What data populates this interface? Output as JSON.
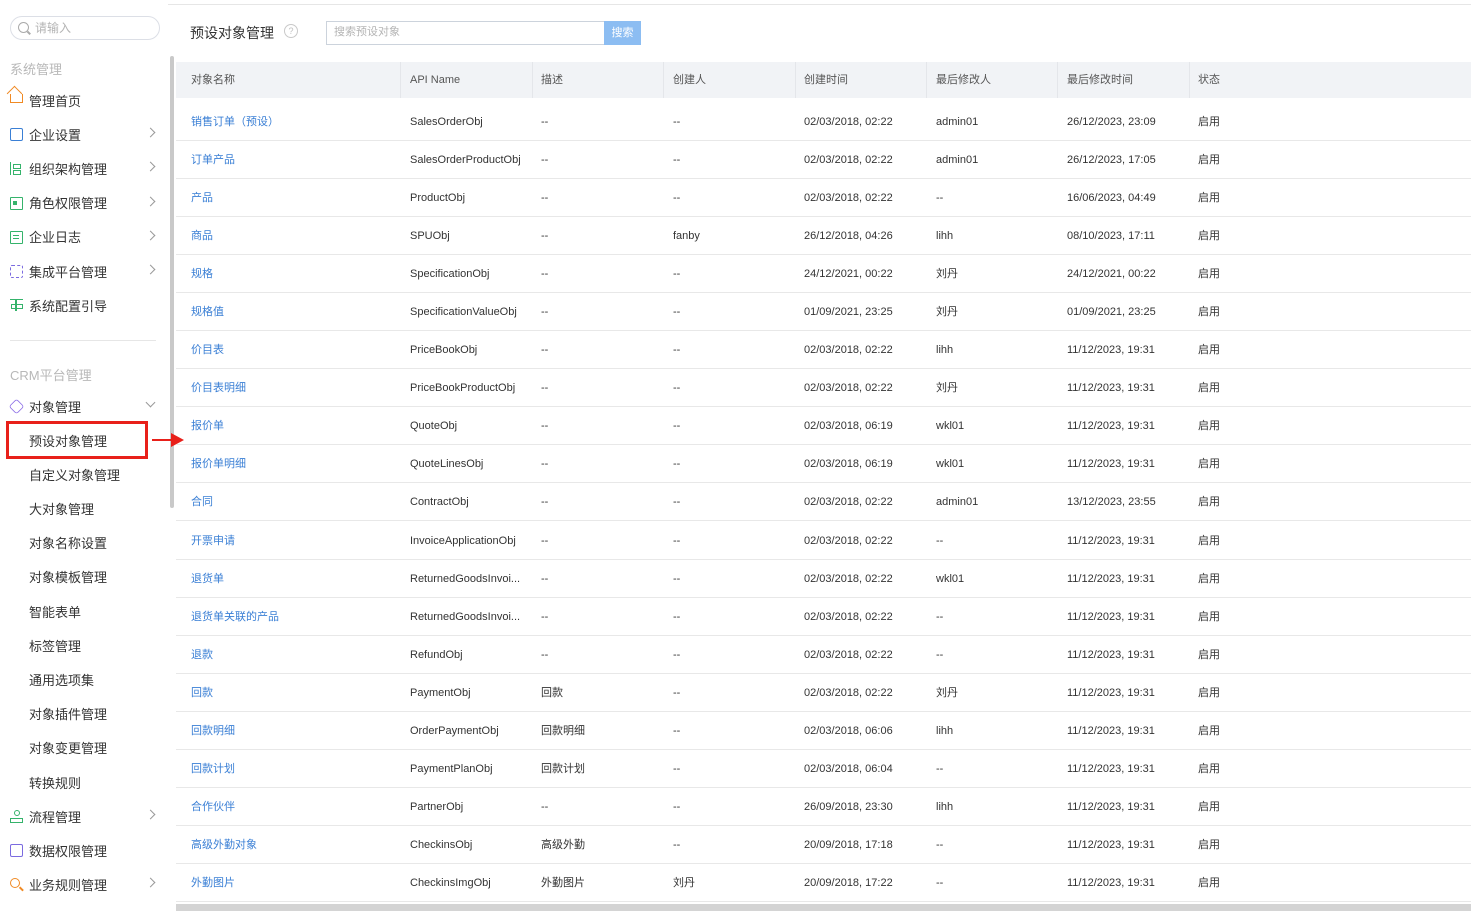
{
  "sidebar": {
    "search_placeholder": "请输入",
    "group_system": "系统管理",
    "system_items": [
      {
        "label": "管理首页",
        "icon": "home-icon",
        "arrow": false
      },
      {
        "label": "企业设置",
        "icon": "enterprise-settings-icon",
        "arrow": true
      },
      {
        "label": "组织架构管理",
        "icon": "org-tree-icon",
        "arrow": true
      },
      {
        "label": "角色权限管理",
        "icon": "role-card-icon",
        "arrow": true
      },
      {
        "label": "企业日志",
        "icon": "log-icon",
        "arrow": true
      },
      {
        "label": "集成平台管理",
        "icon": "integration-chip-icon",
        "arrow": true
      },
      {
        "label": "系统配置引导",
        "icon": "guide-icon",
        "arrow": false
      }
    ],
    "group_crm": "CRM平台管理",
    "object_mgmt": {
      "label": "对象管理",
      "icon": "object-cube-icon",
      "expanded": true
    },
    "object_sub_items": [
      "预设对象管理",
      "自定义对象管理",
      "大对象管理",
      "对象名称设置",
      "对象模板管理",
      "智能表单",
      "标签管理",
      "通用选项集",
      "对象插件管理",
      "对象变更管理",
      "转换规则"
    ],
    "bottom_items": [
      {
        "label": "流程管理",
        "icon": "flow-icon",
        "arrow": true
      },
      {
        "label": "数据权限管理",
        "icon": "data-permission-icon",
        "arrow": false
      },
      {
        "label": "业务规则管理",
        "icon": "business-rule-icon",
        "arrow": true
      }
    ],
    "selected": "预设对象管理",
    "highlight_color": "#e8201a"
  },
  "header": {
    "title": "预设对象管理",
    "help": "?",
    "search_placeholder": "搜索预设对象",
    "search_button": "搜索"
  },
  "table": {
    "columns": [
      "对象名称",
      "API Name",
      "描述",
      "创建人",
      "创建时间",
      "最后修改人",
      "最后修改时间",
      "状态"
    ],
    "rows": [
      [
        "销售订单（预设）",
        "SalesOrderObj",
        "--",
        "--",
        "02/03/2018, 02:22",
        "admin01",
        "26/12/2023, 23:09",
        "启用"
      ],
      [
        "订单产品",
        "SalesOrderProductObj",
        "--",
        "--",
        "02/03/2018, 02:22",
        "admin01",
        "26/12/2023, 17:05",
        "启用"
      ],
      [
        "产品",
        "ProductObj",
        "--",
        "--",
        "02/03/2018, 02:22",
        "--",
        "16/06/2023, 04:49",
        "启用"
      ],
      [
        "商品",
        "SPUObj",
        "--",
        "fanby",
        "26/12/2018, 04:26",
        "lihh",
        "08/10/2023, 17:11",
        "启用"
      ],
      [
        "规格",
        "SpecificationObj",
        "--",
        "--",
        "24/12/2021, 00:22",
        "刘丹",
        "24/12/2021, 00:22",
        "启用"
      ],
      [
        "规格值",
        "SpecificationValueObj",
        "--",
        "--",
        "01/09/2021, 23:25",
        "刘丹",
        "01/09/2021, 23:25",
        "启用"
      ],
      [
        "价目表",
        "PriceBookObj",
        "--",
        "--",
        "02/03/2018, 02:22",
        "lihh",
        "11/12/2023, 19:31",
        "启用"
      ],
      [
        "价目表明细",
        "PriceBookProductObj",
        "--",
        "--",
        "02/03/2018, 02:22",
        "刘丹",
        "11/12/2023, 19:31",
        "启用"
      ],
      [
        "报价单",
        "QuoteObj",
        "--",
        "--",
        "02/03/2018, 06:19",
        "wkl01",
        "11/12/2023, 19:31",
        "启用"
      ],
      [
        "报价单明细",
        "QuoteLinesObj",
        "--",
        "--",
        "02/03/2018, 06:19",
        "wkl01",
        "11/12/2023, 19:31",
        "启用"
      ],
      [
        "合同",
        "ContractObj",
        "--",
        "--",
        "02/03/2018, 02:22",
        "admin01",
        "13/12/2023, 23:55",
        "启用"
      ],
      [
        "开票申请",
        "InvoiceApplicationObj",
        "--",
        "--",
        "02/03/2018, 02:22",
        "--",
        "11/12/2023, 19:31",
        "启用"
      ],
      [
        "退货单",
        "ReturnedGoodsInvoi...",
        "--",
        "--",
        "02/03/2018, 02:22",
        "wkl01",
        "11/12/2023, 19:31",
        "启用"
      ],
      [
        "退货单关联的产品",
        "ReturnedGoodsInvoi...",
        "--",
        "--",
        "02/03/2018, 02:22",
        "--",
        "11/12/2023, 19:31",
        "启用"
      ],
      [
        "退款",
        "RefundObj",
        "--",
        "--",
        "02/03/2018, 02:22",
        "--",
        "11/12/2023, 19:31",
        "启用"
      ],
      [
        "回款",
        "PaymentObj",
        "回款",
        "--",
        "02/03/2018, 02:22",
        "刘丹",
        "11/12/2023, 19:31",
        "启用"
      ],
      [
        "回款明细",
        "OrderPaymentObj",
        "回款明细",
        "--",
        "02/03/2018, 06:06",
        "lihh",
        "11/12/2023, 19:31",
        "启用"
      ],
      [
        "回款计划",
        "PaymentPlanObj",
        "回款计划",
        "--",
        "02/03/2018, 06:04",
        "--",
        "11/12/2023, 19:31",
        "启用"
      ],
      [
        "合作伙伴",
        "PartnerObj",
        "--",
        "--",
        "26/09/2018, 23:30",
        "lihh",
        "11/12/2023, 19:31",
        "启用"
      ],
      [
        "高级外勤对象",
        "CheckinsObj",
        "高级外勤",
        "--",
        "20/09/2018, 17:18",
        "--",
        "11/12/2023, 19:31",
        "启用"
      ],
      [
        "外勤图片",
        "CheckinsImgObj",
        "外勤图片",
        "刘丹",
        "20/09/2018, 17:22",
        "--",
        "11/12/2023, 19:31",
        "启用"
      ]
    ]
  },
  "colors": {
    "accent": "#3a7fd5",
    "search_button": "#8cbdf2",
    "header_bg": "#f1f3f6"
  }
}
